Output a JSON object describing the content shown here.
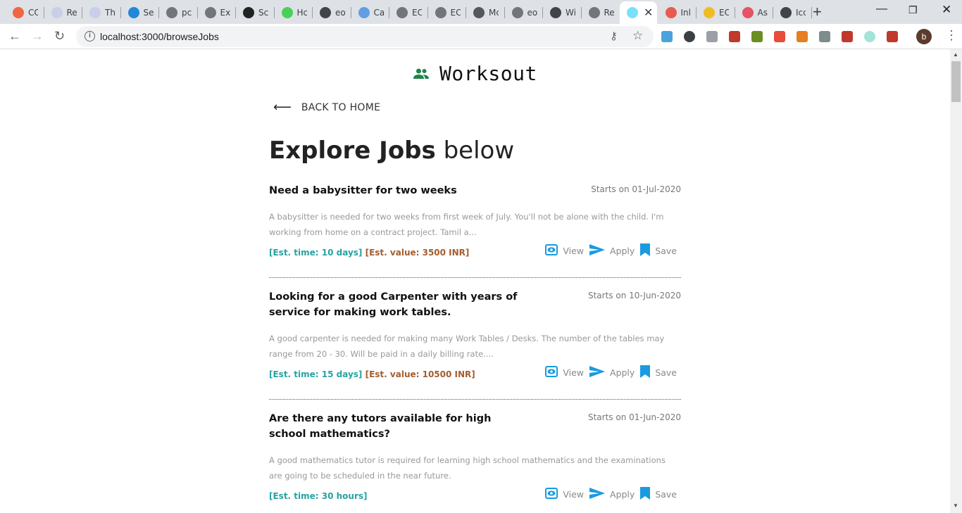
{
  "browser": {
    "tabs": [
      {
        "label": "CC",
        "icon": "windows-icon",
        "color": "#f25022"
      },
      {
        "label": "Re",
        "icon": "doc-icon",
        "color": "#c5cae9"
      },
      {
        "label": "Th",
        "icon": "doc-icon",
        "color": "#c5cae9"
      },
      {
        "label": "Se",
        "icon": "azure-icon",
        "color": "#0078d4"
      },
      {
        "label": "pc",
        "icon": "globe-icon",
        "color": "#5f6368"
      },
      {
        "label": "Ex",
        "icon": "eos-icon",
        "color": "#5f6368"
      },
      {
        "label": "Sc",
        "icon": "medium-icon",
        "color": "#000000"
      },
      {
        "label": "Hc",
        "icon": "power-icon",
        "color": "#2ecc40"
      },
      {
        "label": "eo",
        "icon": "github-icon",
        "color": "#24292e"
      },
      {
        "label": "Ca",
        "icon": "eos-badge-icon",
        "color": "#4a90e2"
      },
      {
        "label": "EC",
        "icon": "eos-icon",
        "color": "#5f6368"
      },
      {
        "label": "EC",
        "icon": "eos-icon",
        "color": "#5f6368"
      },
      {
        "label": "Mc",
        "icon": "diamond-icon",
        "color": "#3c4043"
      },
      {
        "label": "eo",
        "icon": "globe-icon",
        "color": "#5f6368"
      },
      {
        "label": "Wi",
        "icon": "github-icon",
        "color": "#24292e"
      },
      {
        "label": "Re",
        "icon": "eos-icon",
        "color": "#5f6368"
      },
      {
        "label": "",
        "icon": "react-icon",
        "color": "#61dafb",
        "active": true
      },
      {
        "label": "Inl",
        "icon": "gmail-icon",
        "color": "#ea4335"
      },
      {
        "label": "EC",
        "icon": "slides-icon",
        "color": "#f4b400"
      },
      {
        "label": "As",
        "icon": "asana-icon",
        "color": "#e8384f"
      },
      {
        "label": "Icc",
        "icon": "github-icon",
        "color": "#24292e"
      }
    ],
    "url": "localhost:3000/browseJobs",
    "profile_initial": "b"
  },
  "app": {
    "brand": "Worksout",
    "brand_color": "#1e8449",
    "back_label": "BACK TO HOME",
    "heading_bold": "Explore Jobs",
    "heading_light": "below",
    "action_color": "#1a9ae0",
    "actions": {
      "view": "View",
      "apply": "Apply",
      "save": "Save"
    }
  },
  "jobs": [
    {
      "title": "Need a babysitter for two weeks",
      "date": "Starts on 01-Jul-2020",
      "description": "A babysitter is needed for two weeks from first week of July. You'll not be alone with the child. I'm working from home on a contract project. Tamil a...",
      "est_time": "[Est. time: 10 days]",
      "est_value": "[Est. value: 3500 INR]"
    },
    {
      "title": "Looking for a good Carpenter with years of service for making work tables.",
      "date": "Starts on 10-Jun-2020",
      "description": "A good carpenter is needed for making many Work Tables / Desks. The number of the tables may range from 20 - 30. Will be paid in a daily billing rate....",
      "est_time": "[Est. time: 15 days]",
      "est_value": "[Est. value: 10500 INR]"
    },
    {
      "title": "Are there any tutors available for high school mathematics?",
      "date": "Starts on 01-Jun-2020",
      "description": "A good mathematics tutor is required for learning high school mathematics and the examinations are going to be scheduled in the near future.",
      "est_time": "[Est. time: 30 hours]",
      "est_value": ""
    }
  ]
}
